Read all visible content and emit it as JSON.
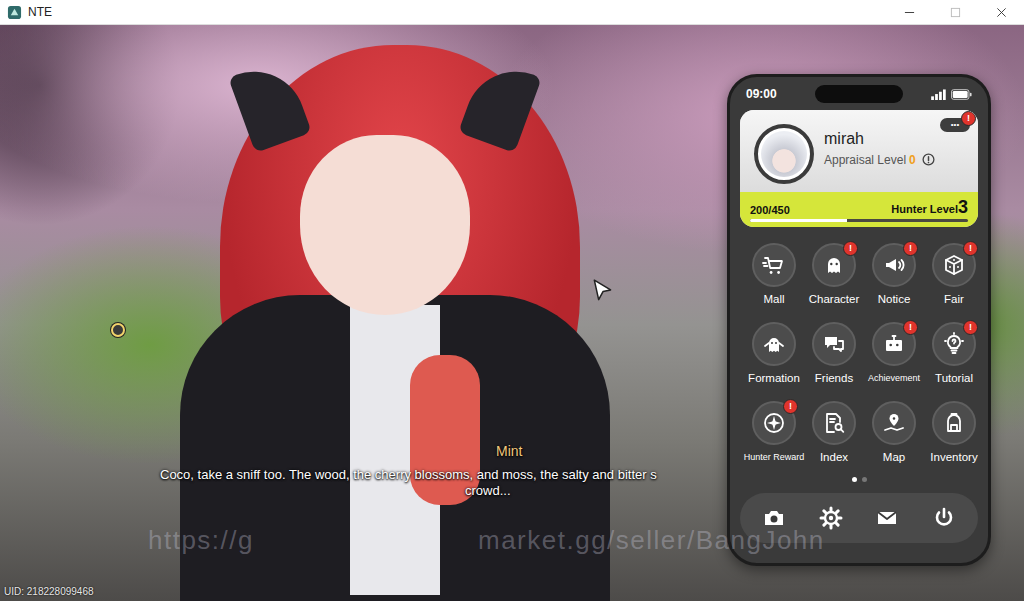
{
  "window": {
    "title": "NTE"
  },
  "dialogue": {
    "speaker": "Mint",
    "lines": [
      "Coco, take a sniff too. The wood, the cherry blossoms, and moss, the salty and bitter s",
      "crowd..."
    ]
  },
  "watermark": [
    "https://g",
    "market.gg/seller/BangJohn"
  ],
  "status": {
    "uid": "UID: 218228099468"
  },
  "phone": {
    "time": "09:00",
    "badge": "!",
    "profile": {
      "name": "mirah",
      "appraisal_label": "Appraisal Level",
      "appraisal_value": "0",
      "more": "•••",
      "more_alert": true,
      "xp": "200/450",
      "level": 0.444,
      "hunter_label": "Hunter Level",
      "hunter_value": "3"
    },
    "apps": [
      {
        "label": "Mall",
        "alert": false
      },
      {
        "label": "Character",
        "alert": true
      },
      {
        "label": "Notice",
        "alert": true
      },
      {
        "label": "Fair",
        "alert": true
      },
      {
        "label": "Formation",
        "alert": false
      },
      {
        "label": "Friends",
        "alert": false
      },
      {
        "label": "Achievement",
        "alert": true
      },
      {
        "label": "Tutorial",
        "alert": true
      },
      {
        "label": "Hunter Reward",
        "alert": true
      },
      {
        "label": "Index",
        "alert": false
      },
      {
        "label": "Map",
        "alert": false
      },
      {
        "label": "Inventory",
        "alert": false
      }
    ],
    "pages": [
      {
        "selected": true
      },
      {
        "selected": false
      }
    ]
  }
}
